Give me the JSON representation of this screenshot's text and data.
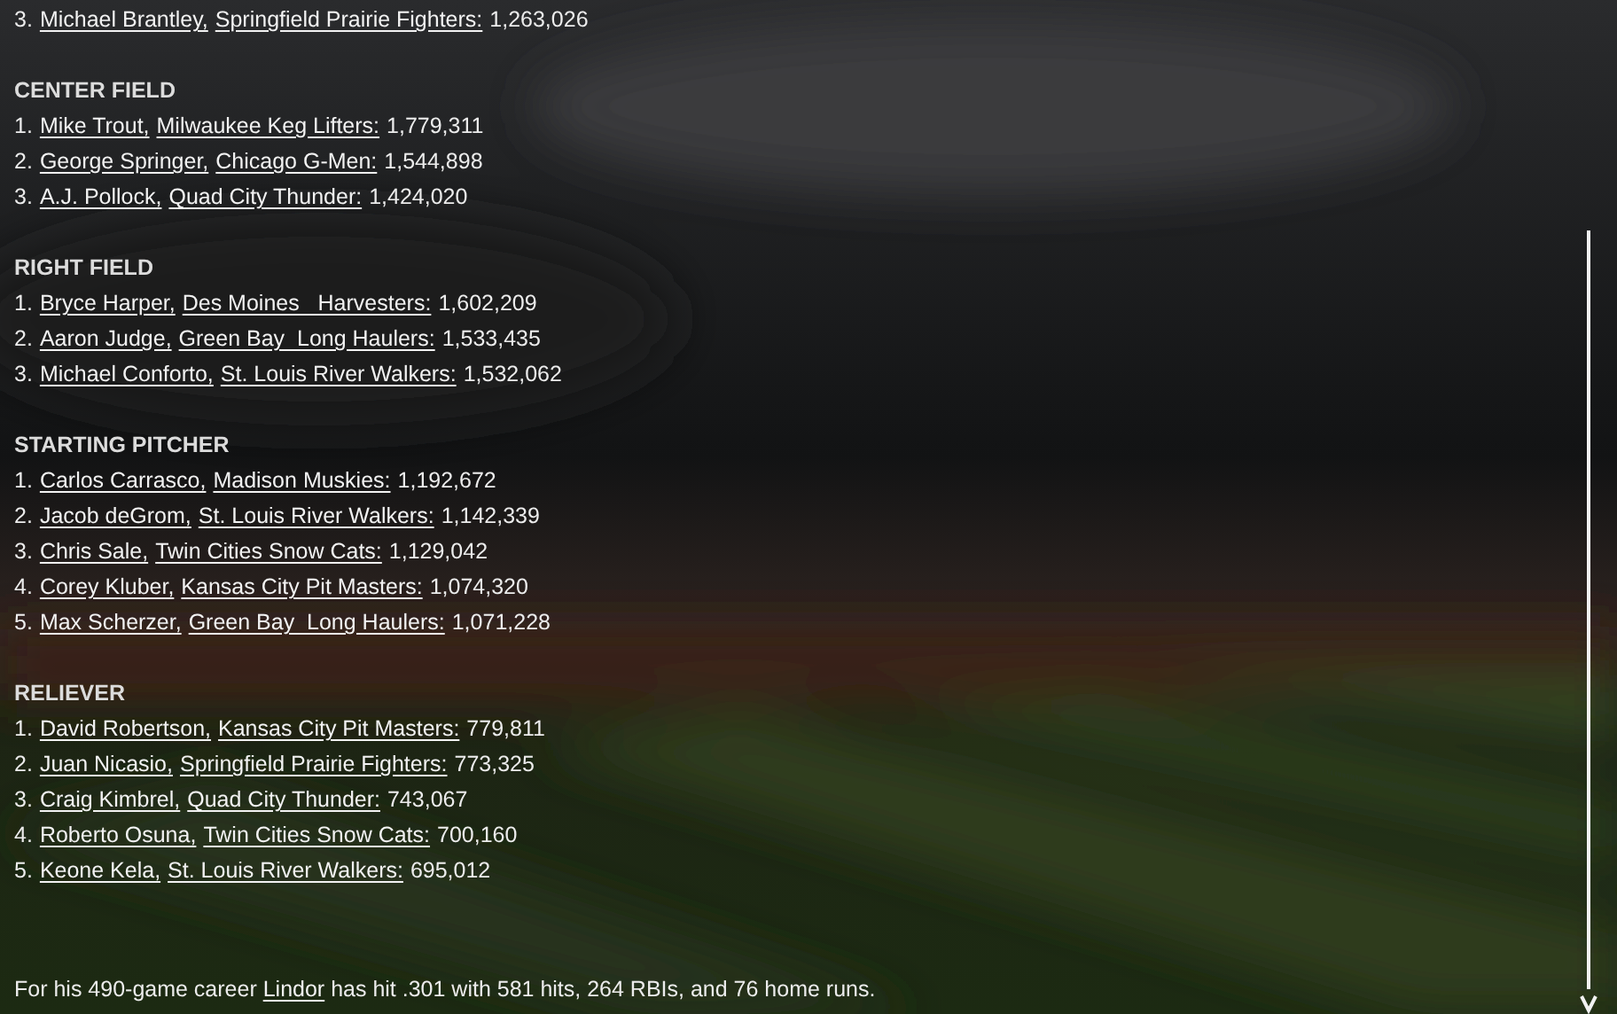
{
  "sections": [
    {
      "entries": [
        {
          "rank": "3.",
          "player": "Michael Brantley,",
          "team": "Springfield Prairie Fighters:",
          "votes": "1,263,026"
        }
      ]
    },
    {
      "title": "CENTER FIELD",
      "entries": [
        {
          "rank": "1.",
          "player": "Mike Trout,",
          "team": "Milwaukee Keg Lifters:",
          "votes": "1,779,311"
        },
        {
          "rank": "2.",
          "player": "George Springer,",
          "team": "Chicago G-Men:",
          "votes": "1,544,898"
        },
        {
          "rank": "3.",
          "player": "A.J. Pollock,",
          "team": "Quad City Thunder:",
          "votes": "1,424,020"
        }
      ]
    },
    {
      "title": "RIGHT FIELD",
      "entries": [
        {
          "rank": "1.",
          "player": "Bryce Harper,",
          "team": "Des Moines   Harvesters:",
          "votes": "1,602,209"
        },
        {
          "rank": "2.",
          "player": "Aaron Judge,",
          "team": "Green Bay  Long Haulers:",
          "votes": "1,533,435"
        },
        {
          "rank": "3.",
          "player": "Michael Conforto,",
          "team": "St. Louis River Walkers:",
          "votes": "1,532,062"
        }
      ]
    },
    {
      "title": "STARTING PITCHER",
      "entries": [
        {
          "rank": "1.",
          "player": "Carlos Carrasco,",
          "team": "Madison Muskies:",
          "votes": "1,192,672"
        },
        {
          "rank": "2.",
          "player": "Jacob deGrom,",
          "team": "St. Louis River Walkers:",
          "votes": "1,142,339"
        },
        {
          "rank": "3.",
          "player": "Chris Sale,",
          "team": "Twin Cities Snow Cats:",
          "votes": "1,129,042"
        },
        {
          "rank": "4.",
          "player": "Corey Kluber,",
          "team": "Kansas City Pit Masters:",
          "votes": "1,074,320"
        },
        {
          "rank": "5.",
          "player": "Max Scherzer,",
          "team": "Green Bay  Long Haulers:",
          "votes": "1,071,228"
        }
      ]
    },
    {
      "title": "RELIEVER",
      "entries": [
        {
          "rank": "1.",
          "player": "David Robertson,",
          "team": "Kansas City Pit Masters:",
          "votes": "779,811"
        },
        {
          "rank": "2.",
          "player": "Juan Nicasio,",
          "team": "Springfield Prairie Fighters:",
          "votes": "773,325"
        },
        {
          "rank": "3.",
          "player": "Craig Kimbrel,",
          "team": "Quad City Thunder:",
          "votes": "743,067"
        },
        {
          "rank": "4.",
          "player": "Roberto Osuna,",
          "team": "Twin Cities Snow Cats:",
          "votes": "700,160"
        },
        {
          "rank": "5.",
          "player": "Keone Kela,",
          "team": "St. Louis River Walkers:",
          "votes": "695,012"
        }
      ]
    }
  ],
  "footer": {
    "before": "For his 490-game career ",
    "link": "Lindor",
    "after": " has hit .301 with 581 hits, 264 RBIs, and 76 home runs."
  }
}
